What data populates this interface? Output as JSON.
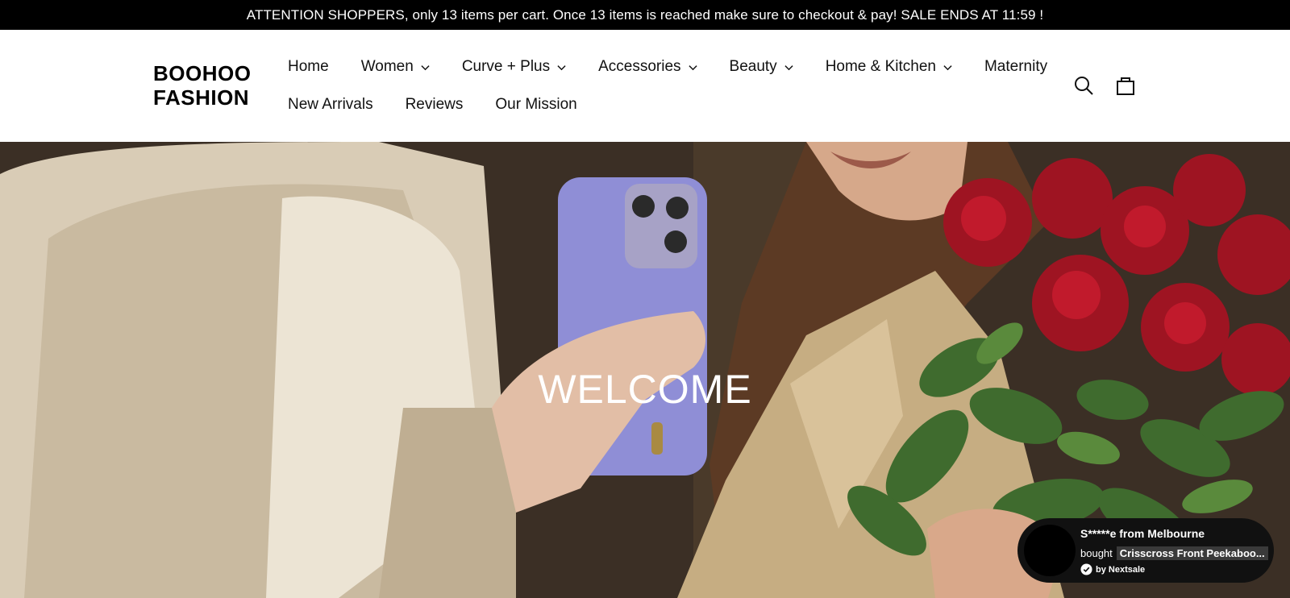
{
  "announcement": "ATTENTION SHOPPERS, only 13 items per cart. Once 13 items is reached make sure to checkout & pay! SALE ENDS AT 11:59 !",
  "logo": {
    "line1": "BOOHOO",
    "line2": "FASHION"
  },
  "nav": {
    "row1": [
      {
        "label": "Home",
        "dropdown": false
      },
      {
        "label": "Women",
        "dropdown": true
      },
      {
        "label": "Curve + Plus",
        "dropdown": true
      },
      {
        "label": "Accessories",
        "dropdown": true
      },
      {
        "label": "Beauty",
        "dropdown": true
      },
      {
        "label": "Home & Kitchen",
        "dropdown": true
      },
      {
        "label": "Maternity",
        "dropdown": false
      }
    ],
    "row2": [
      {
        "label": "New Arrivals",
        "dropdown": false
      },
      {
        "label": "Reviews",
        "dropdown": false
      },
      {
        "label": "Our Mission",
        "dropdown": false
      }
    ]
  },
  "icons": {
    "search": "search-icon",
    "cart": "cart-icon"
  },
  "hero": {
    "title": "WELCOME"
  },
  "toast": {
    "buyer": "S*****e from Melbourne",
    "verb": "bought",
    "product": "Crisscross Front Peekaboo...",
    "provider": "by Nextsale"
  }
}
